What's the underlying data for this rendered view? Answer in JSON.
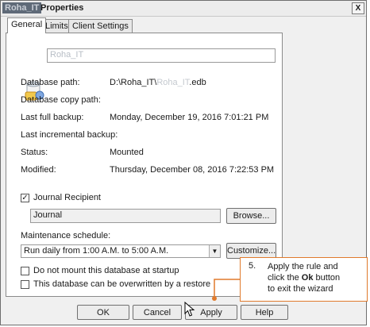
{
  "window": {
    "title_blur": "Roha_IT",
    "title": "Properties",
    "close_glyph": "X"
  },
  "tabs": [
    "General",
    "Limits",
    "Client Settings"
  ],
  "db_name_field": {
    "blurred": "Roha_IT"
  },
  "info": [
    {
      "label": "Database path:",
      "value_prefix": "D:\\Roha_IT\\",
      "value_blur": "Roha_IT",
      "value_suffix": ".edb"
    },
    {
      "label": "Database copy path:",
      "value": ""
    },
    {
      "label": "Last full backup:",
      "value": "Monday, December 19, 2016 7:01:21 PM"
    },
    {
      "label": "Last incremental backup:",
      "value": ""
    },
    {
      "label": "Status:",
      "value": "Mounted"
    },
    {
      "label": "Modified:",
      "value": "Thursday, December 08, 2016 7:22:53 PM"
    }
  ],
  "journal": {
    "checkbox_label": "Journal Recipient",
    "checked": true,
    "value": "Journal",
    "browse_label": "Browse..."
  },
  "maintenance": {
    "label": "Maintenance schedule:",
    "selected": "Run daily from 1:00 A.M. to 5:00 A.M.",
    "customize_label": "Customize..."
  },
  "options": [
    {
      "label": "Do not mount this database at startup",
      "checked": false
    },
    {
      "label": "This database can be overwritten by a restore",
      "checked": false
    }
  ],
  "buttons": {
    "ok": "OK",
    "cancel": "Cancel",
    "apply": "Apply",
    "help": "Help"
  },
  "callout": {
    "number": "5.",
    "line1": "Apply the rule and",
    "line2_pre": "click the ",
    "line2_bold": "Ok",
    "line2_post": " button",
    "line3": "to exit the wizard",
    "border_color": "#e07a2c"
  }
}
